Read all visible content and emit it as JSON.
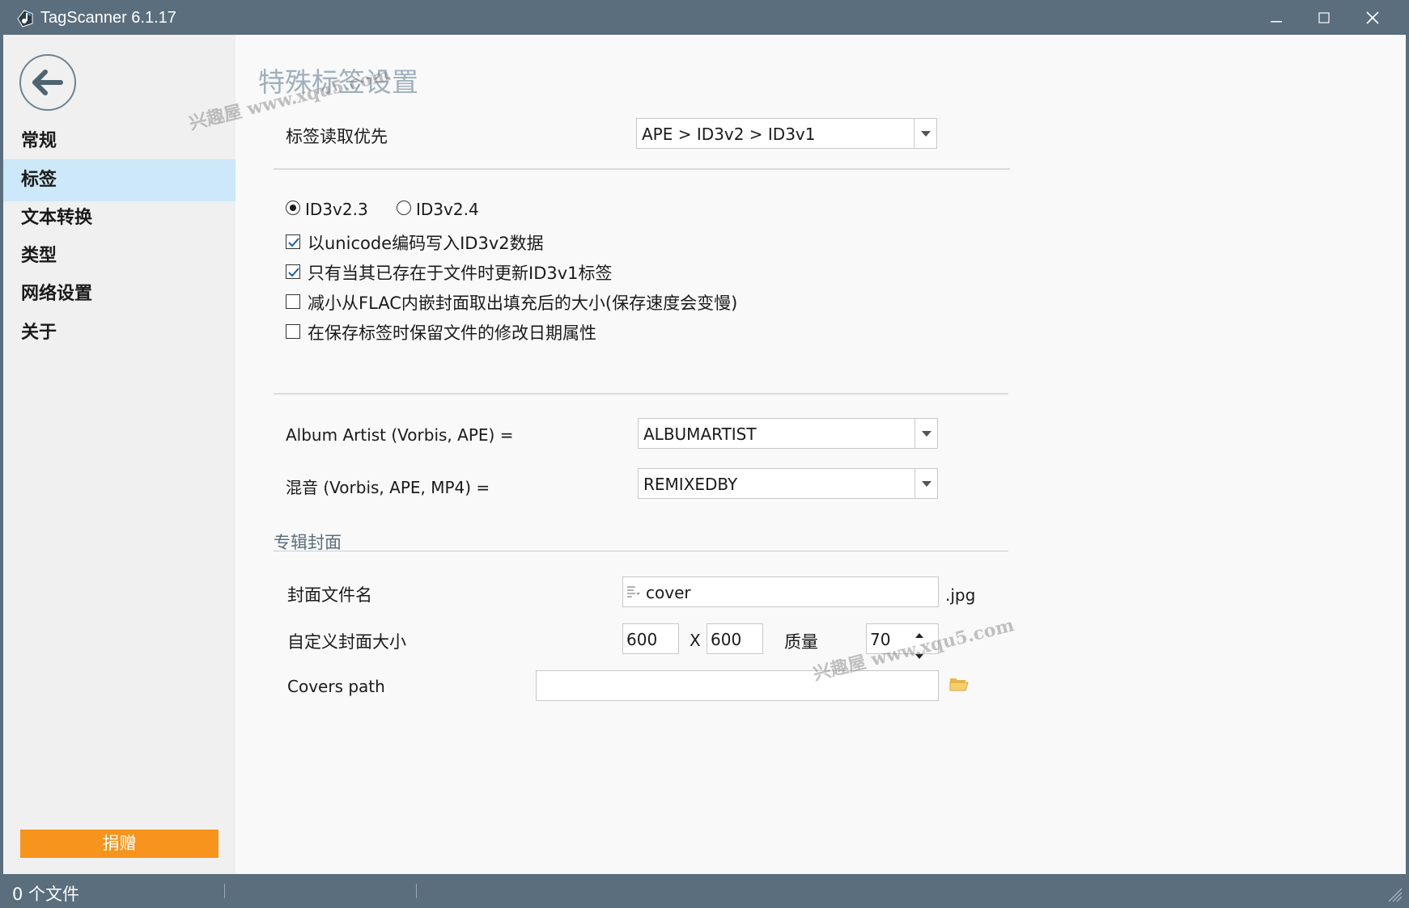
{
  "window": {
    "title": "TagScanner 6.1.17"
  },
  "sidebar": {
    "items": [
      {
        "label": "常规",
        "active": false
      },
      {
        "label": "标签",
        "active": true
      },
      {
        "label": "文本转换",
        "active": false
      },
      {
        "label": "类型",
        "active": false
      },
      {
        "label": "网络设置",
        "active": false
      },
      {
        "label": "关于",
        "active": false
      }
    ],
    "donate_label": "捐赠"
  },
  "main": {
    "title": "特殊标签设置",
    "tag_read_priority": {
      "label": "标签读取优先",
      "value": "APE > ID3v2 > ID3v1"
    },
    "id3_version": {
      "options": [
        "ID3v2.3",
        "ID3v2.4"
      ],
      "selected": "ID3v2.3"
    },
    "checkboxes": [
      {
        "label": "以unicode编码写入ID3v2数据",
        "checked": true
      },
      {
        "label": "只有当其已存在于文件时更新ID3v1标签",
        "checked": true
      },
      {
        "label": "减小从FLAC内嵌封面取出填充后的大小(保存速度会变慢)",
        "checked": false
      },
      {
        "label": "在保存标签时保留文件的修改日期属性",
        "checked": false
      }
    ],
    "album_artist": {
      "label": "Album Artist (Vorbis, APE) =",
      "value": "ALBUMARTIST"
    },
    "remix": {
      "label": "混音 (Vorbis, APE, MP4) =",
      "value": "REMIXEDBY"
    },
    "cover_section": {
      "title": "专辑封面",
      "filename_label": "封面文件名",
      "filename_value": "cover",
      "filename_ext": ".jpg",
      "size_label": "自定义封面大小",
      "width": "600",
      "size_separator": "X",
      "height": "600",
      "quality_label": "质量",
      "quality_value": "70",
      "path_label": "Covers path",
      "path_value": ""
    }
  },
  "statusbar": {
    "files": "0 个文件"
  },
  "watermarks": [
    "兴趣屋 www.xqu5.com",
    "兴趣屋 www.xqu5.com"
  ],
  "colors": {
    "titlebar": "#5a6e7d",
    "sidebar_active": "#cde8f8",
    "donate": "#f7941d",
    "page_title": "#9fb0bd"
  },
  "icons": {
    "app": "tagscanner-app-icon",
    "back": "arrow-left-icon",
    "folder": "folder-open-icon"
  }
}
